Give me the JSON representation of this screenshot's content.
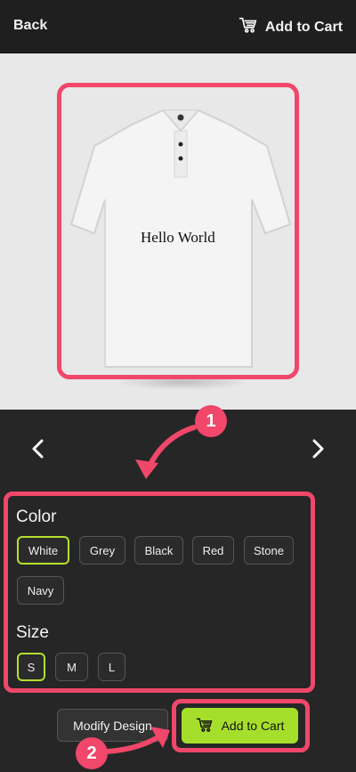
{
  "header": {
    "back_label": "Back",
    "cart_label": "Add to Cart"
  },
  "preview": {
    "text": "Hello World"
  },
  "callouts": {
    "one": "1",
    "two": "2"
  },
  "options": {
    "color_title": "Color",
    "colors": [
      "White",
      "Grey",
      "Black",
      "Red",
      "Stone",
      "Navy"
    ],
    "selected_color": "White",
    "size_title": "Size",
    "sizes": [
      "S",
      "M",
      "L"
    ],
    "selected_size": "S"
  },
  "actions": {
    "modify_label": "Modify Design",
    "add_to_cart_label": "Add to Cart"
  },
  "colors": {
    "accent": "#a6df2b",
    "highlight": "#f0476a"
  }
}
